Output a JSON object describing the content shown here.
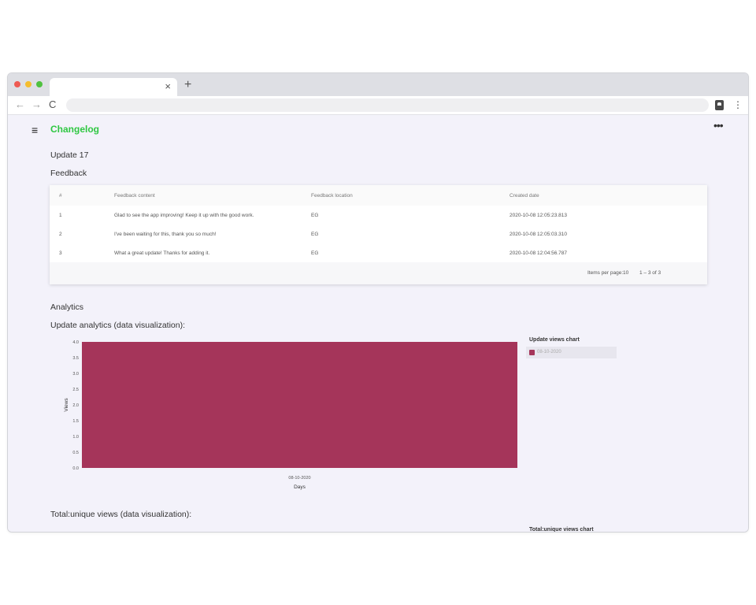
{
  "browser": {
    "tab_close": "×",
    "new_tab": "+",
    "back": "←",
    "forward": "→",
    "reload": "C",
    "menu": "⋮"
  },
  "app": {
    "menu_icon": "≡",
    "title": "Changelog",
    "more_icon": "•••",
    "accent_color": "#2fc742"
  },
  "page": {
    "update_title": "Update 17",
    "feedback_title": "Feedback",
    "analytics_title": "Analytics",
    "update_analytics_title": "Update analytics (data visualization):",
    "total_unique_title": "Total:unique views (data visualization):"
  },
  "table": {
    "headers": [
      "#",
      "Feedback content",
      "Feedback location",
      "Created date"
    ],
    "rows": [
      [
        "1",
        "Glad to see the app improving! Keep it up with the good work.",
        "EG",
        "2020-10-08 12:05:23.813"
      ],
      [
        "2",
        "I've been waiting for this, thank you so much!",
        "EG",
        "2020-10-08 12:05:03.310"
      ],
      [
        "3",
        "What a great update! Thanks for adding it.",
        "EG",
        "2020-10-08 12:04:56.787"
      ]
    ],
    "items_per_page_label": "Items per page:",
    "items_per_page_value": "10",
    "range_label": "1 – 3 of 3"
  },
  "chart_data": [
    {
      "type": "bar",
      "categories": [
        "08-10-2020"
      ],
      "series": [
        {
          "name": "08-10-2020",
          "values": [
            4.0
          ]
        }
      ],
      "xlabel": "Days",
      "ylabel": "Views",
      "ylim": [
        0,
        4
      ],
      "yticks": [
        "0.0",
        "0.5",
        "1.0",
        "1.5",
        "2.0",
        "2.5",
        "3.0",
        "3.5",
        "4.0"
      ],
      "legend_title": "Update views chart",
      "legend_position": "right",
      "bar_color": "#a5355a"
    },
    {
      "type": "bar",
      "legend_title": "Total:unique views chart"
    }
  ]
}
